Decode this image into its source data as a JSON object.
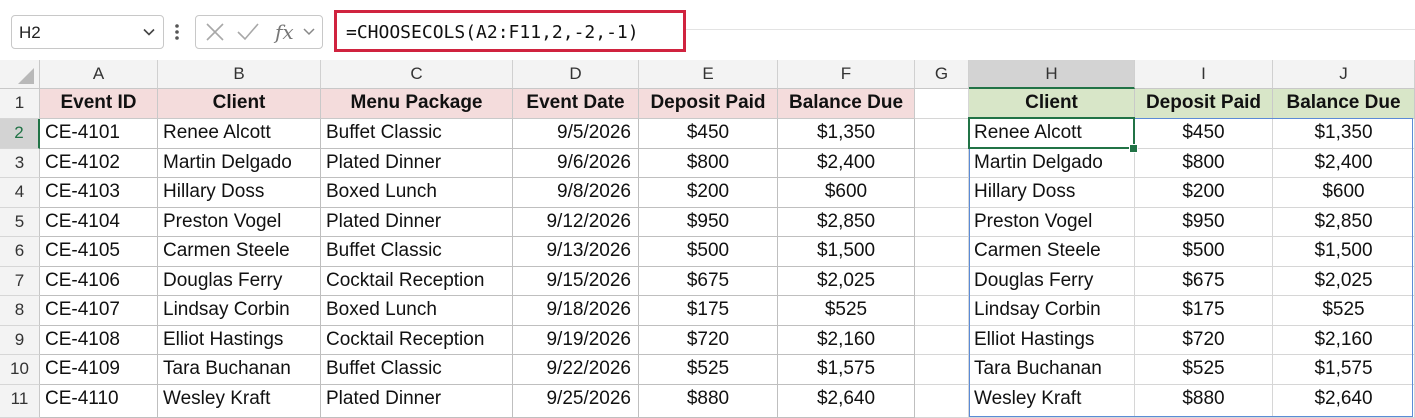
{
  "name_box": {
    "value": "H2",
    "dropdown_icon": "chevron-down-icon"
  },
  "formula_bar": {
    "icons": [
      "cancel-icon",
      "enter-check-icon",
      "insert-function-icon",
      "expand-chevron-icon"
    ],
    "fx_label": "fx",
    "formula": "=CHOOSECOLS(A2:F11,2,-2,-1)",
    "highlight_color": "#d0233f"
  },
  "columns": [
    "A",
    "B",
    "C",
    "D",
    "E",
    "F",
    "G",
    "H",
    "I",
    "J"
  ],
  "selected_column": "H",
  "selected_row": 2,
  "rows": [
    "1",
    "2",
    "3",
    "4",
    "5",
    "6",
    "7",
    "8",
    "9",
    "10",
    "11"
  ],
  "source_table": {
    "header_color": "#f4dcdc",
    "headers": [
      "Event ID",
      "Client",
      "Menu Package",
      "Event Date",
      "Deposit Paid",
      "Balance Due"
    ],
    "rows": [
      [
        "CE-4101",
        "Renee Alcott",
        "Buffet Classic",
        "9/5/2026",
        "$450",
        "$1,350"
      ],
      [
        "CE-4102",
        "Martin Delgado",
        "Plated Dinner",
        "9/6/2026",
        "$800",
        "$2,400"
      ],
      [
        "CE-4103",
        "Hillary Doss",
        "Boxed Lunch",
        "9/8/2026",
        "$200",
        "$600"
      ],
      [
        "CE-4104",
        "Preston Vogel",
        "Plated Dinner",
        "9/12/2026",
        "$950",
        "$2,850"
      ],
      [
        "CE-4105",
        "Carmen Steele",
        "Buffet Classic",
        "9/13/2026",
        "$500",
        "$1,500"
      ],
      [
        "CE-4106",
        "Douglas Ferry",
        "Cocktail Reception",
        "9/15/2026",
        "$675",
        "$2,025"
      ],
      [
        "CE-4107",
        "Lindsay Corbin",
        "Boxed Lunch",
        "9/18/2026",
        "$175",
        "$525"
      ],
      [
        "CE-4108",
        "Elliot Hastings",
        "Cocktail Reception",
        "9/19/2026",
        "$720",
        "$2,160"
      ],
      [
        "CE-4109",
        "Tara Buchanan",
        "Buffet Classic",
        "9/22/2026",
        "$525",
        "$1,575"
      ],
      [
        "CE-4110",
        "Wesley Kraft",
        "Plated Dinner",
        "9/25/2026",
        "$880",
        "$2,640"
      ]
    ]
  },
  "result_table": {
    "header_color": "#d8e6c8",
    "spill_border_color": "#5b8bd6",
    "headers": [
      "Client",
      "Deposit Paid",
      "Balance Due"
    ],
    "rows": [
      [
        "Renee Alcott",
        "$450",
        "$1,350"
      ],
      [
        "Martin Delgado",
        "$800",
        "$2,400"
      ],
      [
        "Hillary Doss",
        "$200",
        "$600"
      ],
      [
        "Preston Vogel",
        "$950",
        "$2,850"
      ],
      [
        "Carmen Steele",
        "$500",
        "$1,500"
      ],
      [
        "Douglas Ferry",
        "$675",
        "$2,025"
      ],
      [
        "Lindsay Corbin",
        "$175",
        "$525"
      ],
      [
        "Elliot Hastings",
        "$720",
        "$2,160"
      ],
      [
        "Tara Buchanan",
        "$525",
        "$1,575"
      ],
      [
        "Wesley Kraft",
        "$880",
        "$2,640"
      ]
    ]
  }
}
